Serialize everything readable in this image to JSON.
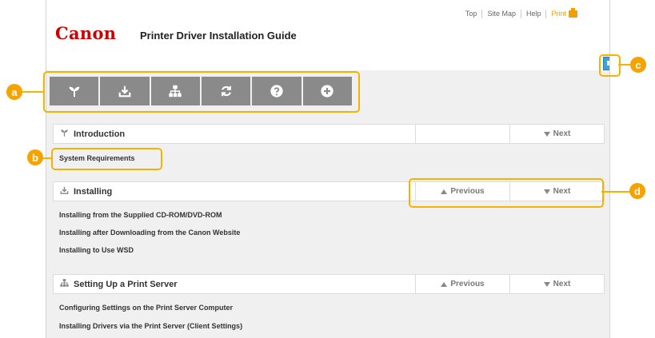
{
  "header": {
    "logo": "Canon",
    "title": "Printer Driver Installation Guide",
    "links": [
      "Top",
      "Site Map",
      "Help"
    ],
    "print_label": "Print"
  },
  "toolbar": {
    "buttons": [
      {
        "icon": "sprout-icon"
      },
      {
        "icon": "download-icon"
      },
      {
        "icon": "network-icon"
      },
      {
        "icon": "refresh-icon"
      },
      {
        "icon": "help-icon"
      },
      {
        "icon": "plus-icon"
      }
    ]
  },
  "sections": {
    "introduction": {
      "title": "Introduction",
      "next": "Next",
      "links": [
        "System Requirements"
      ]
    },
    "installing": {
      "title": "Installing",
      "previous": "Previous",
      "next": "Next",
      "links": [
        "Installing from the Supplied CD-ROM/DVD-ROM",
        "Installing after Downloading from the Canon Website",
        "Installing to Use WSD"
      ]
    },
    "print_server": {
      "title": "Setting Up a Print Server",
      "previous": "Previous",
      "next": "Next",
      "links": [
        "Configuring Settings on the Print Server Computer",
        "Installing Drivers via the Print Server (Client Settings)"
      ]
    }
  },
  "callouts": [
    "a",
    "b",
    "c",
    "d"
  ],
  "colors": {
    "brand": "#cc0000",
    "callout": "#f5a300",
    "toolbar": "#8a8a8a",
    "side_button": "#3fa0d9"
  }
}
